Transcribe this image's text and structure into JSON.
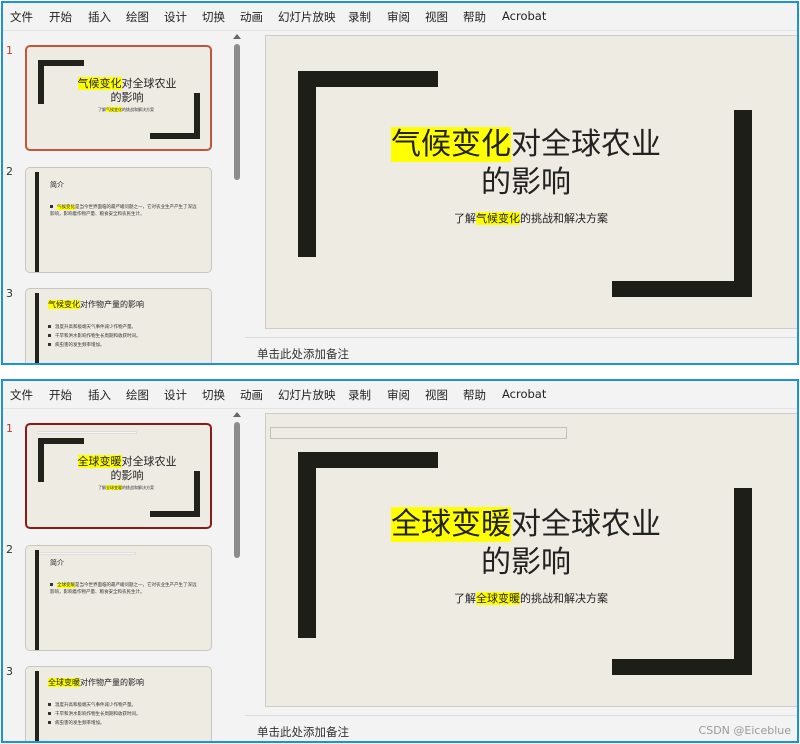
{
  "menu": [
    "文件",
    "开始",
    "插入",
    "绘图",
    "设计",
    "切换",
    "动画",
    "幻灯片放映",
    "录制",
    "审阅",
    "视图",
    "帮助",
    "Acrobat"
  ],
  "common": {
    "title_rest_1": "对全球农业",
    "title_line2": "的影响",
    "sub_pre": "了解",
    "sub_post": "的挑战和解决方案",
    "slide2_heading": "简介",
    "slide2_body_rest": "是当今世界面临的最严峻问题之一，它对农业生产产生了深远影响，影响着作物产量、粮食安全和农民生计。",
    "slide3_heading_rest": "对作物产量的影响",
    "slide3_lines": [
      "温度升高和极端天气事件减少作物产量。",
      "干旱和洪水影响作物生长周期和收获时间。",
      "病虫害的发生频率增加。"
    ],
    "notes_placeholder": "单击此处添加备注"
  },
  "top": {
    "keyword": "气候变化",
    "slide_numbers": [
      "1",
      "2",
      "3"
    ]
  },
  "bottom": {
    "keyword": "全球变暖",
    "slide_numbers": [
      "1",
      "2",
      "3"
    ]
  },
  "watermark": "CSDN @Eiceblue",
  "colors": {
    "window_border": "#1f8fe0",
    "highlight": "#ffff00",
    "slide_bg": "#eeebe3",
    "bar": "#1e1e18"
  }
}
